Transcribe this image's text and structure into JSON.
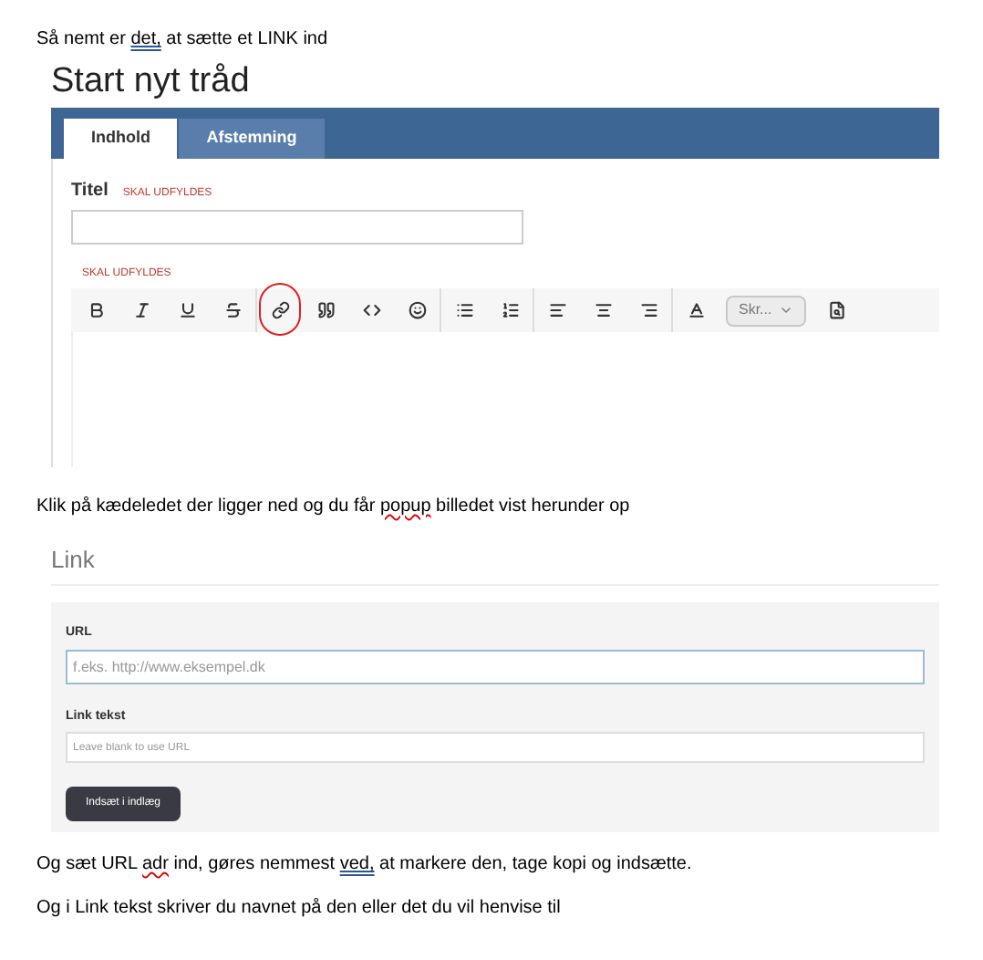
{
  "paragraphs_top": [
    {
      "segments": [
        {
          "text": "Så nemt er ",
          "spelling_error": false,
          "grammar_error": false
        },
        {
          "text": "det,",
          "spelling_error": false,
          "grammar_error": true
        },
        {
          "text": " at sætte et LINK ind",
          "spelling_error": false,
          "grammar_error": false
        }
      ]
    }
  ],
  "editor_shot": {
    "heading": "Start nyt tråd",
    "tabs": [
      {
        "label": "Indhold",
        "selected": true
      },
      {
        "label": "Afstemning",
        "selected": false
      }
    ],
    "title_label": "Titel",
    "title_required": "SKAL UDFYLDES",
    "body_required": "SKAL UDFYLDES",
    "toolbar_groups": [
      [
        {
          "kind": "bold",
          "circled": false
        },
        {
          "kind": "italic",
          "circled": false
        },
        {
          "kind": "underline",
          "circled": false
        },
        {
          "kind": "strike",
          "circled": false
        }
      ],
      [
        {
          "kind": "link",
          "circled": true
        },
        {
          "kind": "quote",
          "circled": false
        },
        {
          "kind": "code",
          "circled": false
        },
        {
          "kind": "emoji",
          "circled": false
        }
      ],
      [
        {
          "kind": "bullets",
          "circled": false
        },
        {
          "kind": "numbers",
          "circled": false
        }
      ],
      [
        {
          "kind": "align-left",
          "circled": false
        },
        {
          "kind": "align-center",
          "circled": false
        },
        {
          "kind": "align-right",
          "circled": false
        }
      ],
      [
        {
          "kind": "text-color",
          "circled": false
        },
        {
          "kind": "dropdown",
          "label": "Skr...",
          "circled": false
        },
        {
          "kind": "preview",
          "circled": false
        }
      ]
    ]
  },
  "paragraph_middle": {
    "segments": [
      {
        "text": "Klik på kædeledet der ligger ned og du får ",
        "spelling_error": false,
        "grammar_error": false
      },
      {
        "text": "popup",
        "spelling_error": true,
        "grammar_error": false
      },
      {
        "text": " billedet vist herunder op",
        "spelling_error": false,
        "grammar_error": false
      }
    ]
  },
  "link_shot": {
    "title": "Link",
    "url_label": "URL",
    "url_placeholder": "f.eks. http://www.eksempel.dk",
    "text_label": "Link tekst",
    "text_placeholder": "Leave blank to use URL",
    "button": "Indsæt i indlæg"
  },
  "paragraphs_bottom": [
    {
      "segments": [
        {
          "text": "Og sæt URL ",
          "spelling_error": false,
          "grammar_error": false
        },
        {
          "text": "adr",
          "spelling_error": true,
          "grammar_error": false
        },
        {
          "text": " ind, gøres nemmest ",
          "spelling_error": false,
          "grammar_error": false
        },
        {
          "text": "ved,",
          "spelling_error": false,
          "grammar_error": true
        },
        {
          "text": " at markere den, tage kopi og indsætte.",
          "spelling_error": false,
          "grammar_error": false
        }
      ]
    },
    {
      "segments": [
        {
          "text": "Og i Link tekst skriver du navnet på den eller det du vil henvise til",
          "spelling_error": false,
          "grammar_error": false
        }
      ]
    }
  ]
}
